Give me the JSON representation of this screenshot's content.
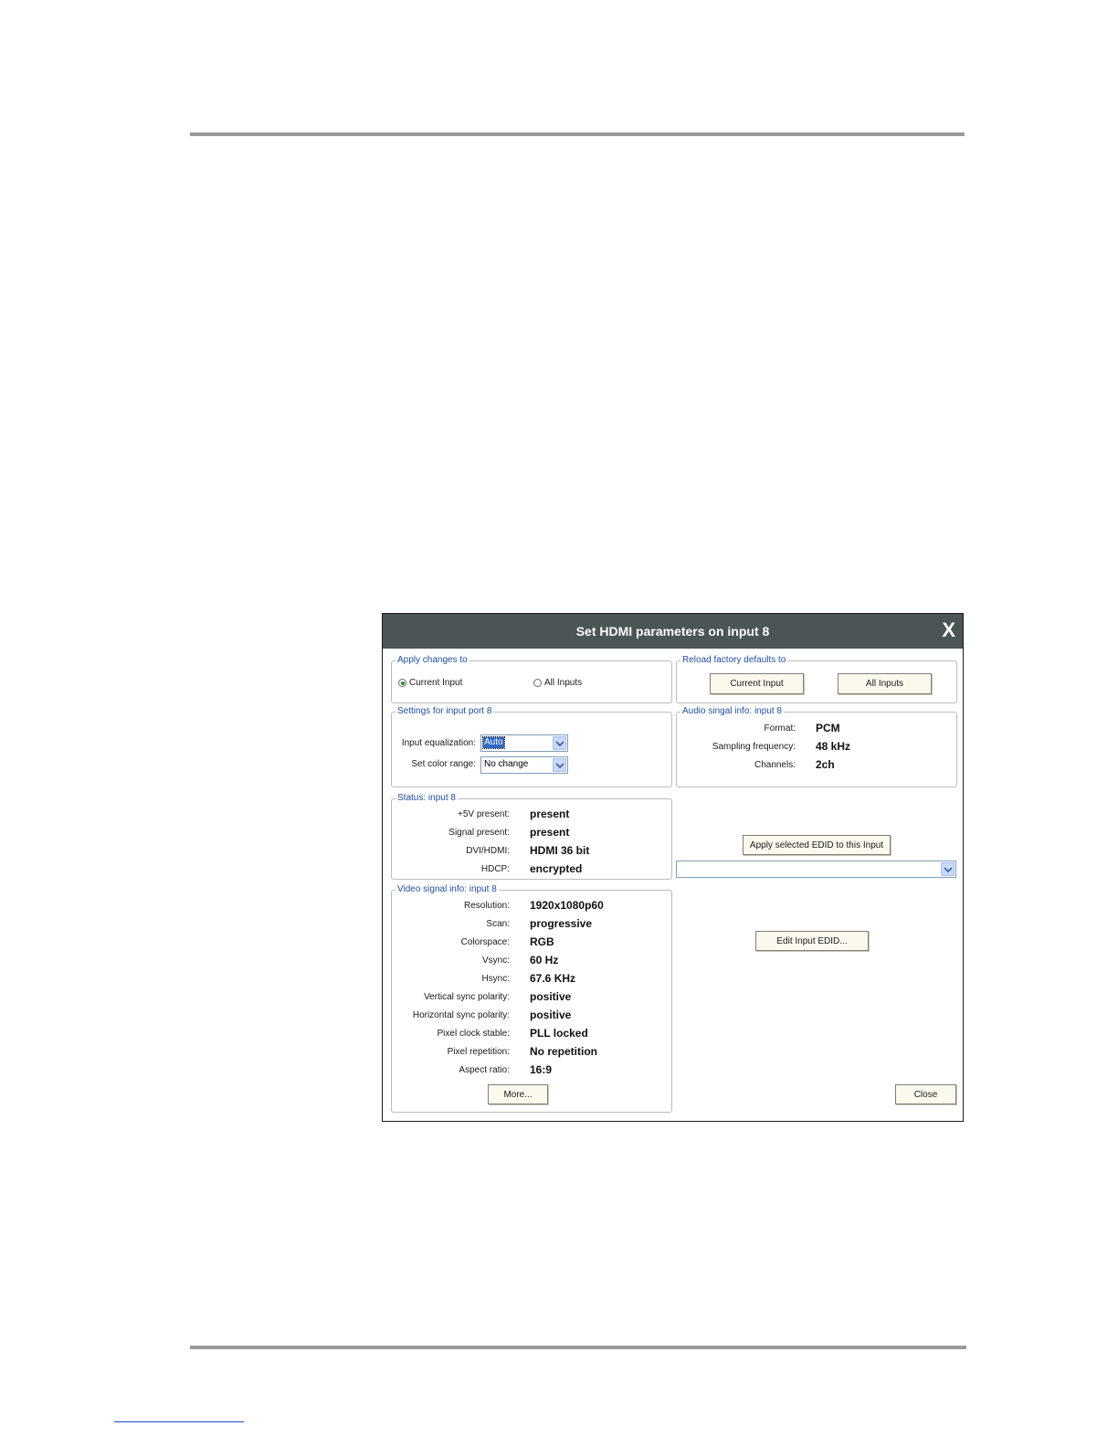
{
  "dialog": {
    "title": "Set HDMI parameters on input 8",
    "close_label": "X",
    "apply_changes": {
      "legend": "Apply changes to",
      "options": [
        {
          "label": "Current Input",
          "selected": true
        },
        {
          "label": "All Inputs",
          "selected": false
        }
      ]
    },
    "reload_defaults": {
      "legend": "Reload factory defaults to",
      "current_input_button": "Current Input",
      "all_inputs_button": "All Inputs"
    },
    "settings": {
      "legend": "Settings for input port 8",
      "equalization_label": "Input equalization:",
      "equalization_value": "Auto",
      "color_range_label": "Set color range:",
      "color_range_value": "No change"
    },
    "audio": {
      "legend": "Audio singal info: input 8",
      "rows": [
        {
          "label": "Format:",
          "value": "PCM"
        },
        {
          "label": "Sampling frequency:",
          "value": "48 kHz"
        },
        {
          "label": "Channels:",
          "value": "2ch"
        }
      ]
    },
    "status": {
      "legend": "Status: input 8",
      "rows": [
        {
          "label": "+5V present:",
          "value": "present"
        },
        {
          "label": "Signal present:",
          "value": "present"
        },
        {
          "label": "DVI/HDMI:",
          "value": "HDMI 36 bit"
        },
        {
          "label": "HDCP:",
          "value": "encrypted"
        }
      ]
    },
    "edid": {
      "apply_button": "Apply selected EDID to this Input",
      "select_value": "",
      "edit_button": "Edit Input EDID..."
    },
    "video": {
      "legend": "Video signal info: input 8",
      "rows": [
        {
          "label": "Resolution:",
          "value": "1920x1080p60"
        },
        {
          "label": "Scan:",
          "value": "progressive"
        },
        {
          "label": "Colorspace:",
          "value": "RGB"
        },
        {
          "label": "Vsync:",
          "value": "60 Hz"
        },
        {
          "label": "Hsync:",
          "value": "67.6 KHz"
        },
        {
          "label": "Vertical sync polarity:",
          "value": "positive"
        },
        {
          "label": "Horizontal sync polarity:",
          "value": "positive"
        },
        {
          "label": "Pixel clock stable:",
          "value": "PLL locked"
        },
        {
          "label": "Pixel repetition:",
          "value": "No repetition"
        },
        {
          "label": "Aspect ratio:",
          "value": "16:9"
        }
      ],
      "more_button": "More..."
    },
    "close_button": "Close"
  },
  "colors": {
    "titlebar": "#4c5555",
    "legend_text": "#1f4e9c",
    "button_bg": "#fbf9ee",
    "selection": "#3168c4",
    "radio_dot": "#2a8a2a"
  },
  "icons": {
    "dropdown": "chevron-down-icon",
    "radio": "radio-icon"
  }
}
